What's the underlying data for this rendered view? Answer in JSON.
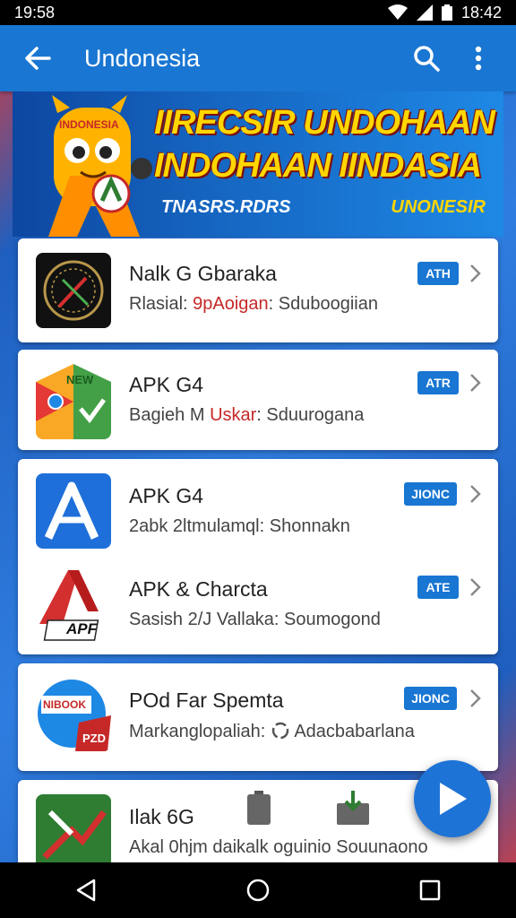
{
  "status_bar": {
    "time_left": "19:58",
    "time_right": "18:42"
  },
  "app_bar": {
    "title": "Undonesia"
  },
  "banner": {
    "mascot_label": "INDONESIA",
    "headline_1": "IIRECSIR UNDOHAAN",
    "headline_2": "INDOHAAN IINDASIA",
    "tag_left": "TNASRS.RDRS",
    "tag_right": "UNONESIR"
  },
  "apps": [
    {
      "name": "Nalk G Gbaraka",
      "sub_a": "Rlasial: ",
      "sub_accent": "9pAoigan",
      "sub_b": ": Sduboogiian",
      "badge": "ATH"
    },
    {
      "name": "APK G4",
      "sub_a": "Bagieh M ",
      "sub_accent": "Uskar",
      "sub_b": ": Sduurogana",
      "badge": "ATR",
      "icon_label": "NEW"
    },
    {
      "name": "APK G4",
      "sub_a": "2abk 2ltmulamql: Shonnakn",
      "sub_accent": "",
      "sub_b": "",
      "badge": "JIONC"
    },
    {
      "name": "APK & Charcta",
      "sub_a": "Sasish 2/J Vallaka: Soumogond",
      "sub_accent": "",
      "sub_b": "",
      "badge": "ATE",
      "icon_label": "APF"
    },
    {
      "name": "POd Far Spemta",
      "sub_a": "Markanglopaliah: ",
      "sub_accent": "",
      "sub_b": "Adacbabarlana",
      "badge": "JIONC",
      "icon_label": "NIBOOK",
      "icon_label_2": "PZD"
    },
    {
      "name": "Ilak 6G",
      "sub_a": "Akal 0hjm daikalk oguinio Souunaono",
      "sub_accent": "",
      "sub_b": "",
      "badge": ""
    }
  ],
  "colors": {
    "primary": "#1976d2",
    "accent_red": "#c62828",
    "banner_yellow": "#ffd600"
  }
}
